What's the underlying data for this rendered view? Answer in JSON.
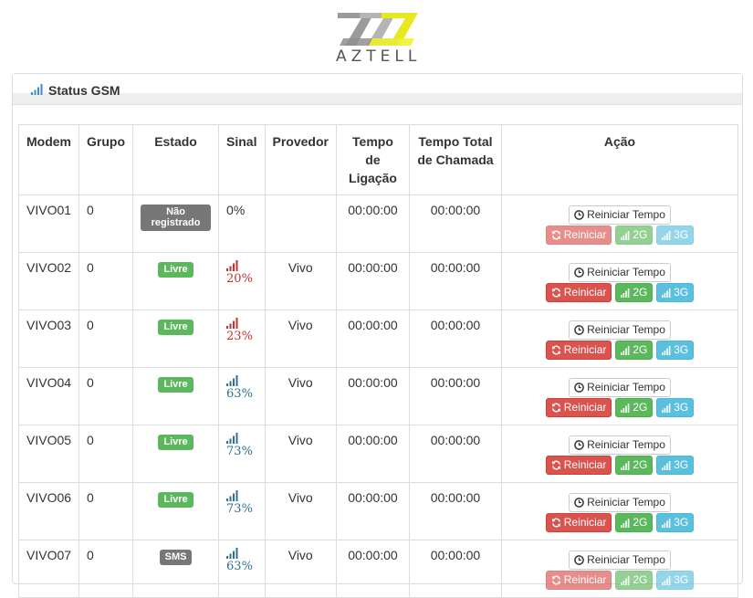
{
  "brand": {
    "name": "AZTELL"
  },
  "panel": {
    "title": "Status GSM",
    "title_icon": "signal-bars-icon"
  },
  "table": {
    "headers": {
      "modem": "Modem",
      "grupo": "Grupo",
      "estado": "Estado",
      "sinal": "Sinal",
      "provedor": "Provedor",
      "tempo_ligacao": "Tempo de Ligação",
      "tempo_total": "Tempo Total de Chamada",
      "acao": "Ação"
    },
    "rows": [
      {
        "modem": "VIVO01",
        "grupo": "0",
        "estado": "Não registrado",
        "estado_color": "#777777",
        "sinal": "0%",
        "sinal_level": 0,
        "provedor": "",
        "tempo_ligacao": "00:00:00",
        "tempo_total": "00:00:00",
        "actions_enabled": false
      },
      {
        "modem": "VIVO02",
        "grupo": "0",
        "estado": "Livre",
        "estado_color": "#5cb85c",
        "sinal": "20%",
        "sinal_level": 20,
        "sinal_color": "#c9302c",
        "provedor": "Vivo",
        "tempo_ligacao": "00:00:00",
        "tempo_total": "00:00:00",
        "actions_enabled": true
      },
      {
        "modem": "VIVO03",
        "grupo": "0",
        "estado": "Livre",
        "estado_color": "#5cb85c",
        "sinal": "23%",
        "sinal_level": 23,
        "sinal_color": "#c9302c",
        "provedor": "Vivo",
        "tempo_ligacao": "00:00:00",
        "tempo_total": "00:00:00",
        "actions_enabled": true
      },
      {
        "modem": "VIVO04",
        "grupo": "0",
        "estado": "Livre",
        "estado_color": "#5cb85c",
        "sinal": "63%",
        "sinal_level": 63,
        "sinal_color": "#31708f",
        "provedor": "Vivo",
        "tempo_ligacao": "00:00:00",
        "tempo_total": "00:00:00",
        "actions_enabled": true
      },
      {
        "modem": "VIVO05",
        "grupo": "0",
        "estado": "Livre",
        "estado_color": "#5cb85c",
        "sinal": "73%",
        "sinal_level": 73,
        "sinal_color": "#31708f",
        "provedor": "Vivo",
        "tempo_ligacao": "00:00:00",
        "tempo_total": "00:00:00",
        "actions_enabled": true
      },
      {
        "modem": "VIVO06",
        "grupo": "0",
        "estado": "Livre",
        "estado_color": "#5cb85c",
        "sinal": "73%",
        "sinal_level": 73,
        "sinal_color": "#31708f",
        "provedor": "Vivo",
        "tempo_ligacao": "00:00:00",
        "tempo_total": "00:00:00",
        "actions_enabled": true
      },
      {
        "modem": "VIVO07",
        "grupo": "0",
        "estado": "SMS",
        "estado_color": "#777777",
        "sinal": "63%",
        "sinal_level": 63,
        "sinal_color": "#31708f",
        "provedor": "Vivo",
        "tempo_ligacao": "00:00:00",
        "tempo_total": "00:00:00",
        "actions_enabled": false
      }
    ]
  },
  "actions": {
    "reset_time": "Reiniciar Tempo",
    "restart": "Reiniciar",
    "set_2g": "2G",
    "set_3g": "3G",
    "icons": {
      "reset_time": "clock-icon",
      "restart": "refresh-icon",
      "set_2g": "signal-icon",
      "set_3g": "signal-icon"
    }
  }
}
